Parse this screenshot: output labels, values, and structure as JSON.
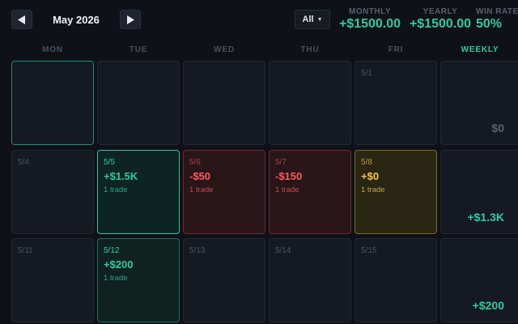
{
  "header": {
    "month": "May 2026",
    "filter_label": "All",
    "stats": {
      "monthly_label": "MONTHLY",
      "monthly_value": "+$1500.00",
      "yearly_label": "YEARLY",
      "yearly_value": "+$1500.00",
      "winrate_label": "WIN RATE",
      "winrate_value": "50%"
    }
  },
  "weekdays": [
    "MON",
    "TUE",
    "WED",
    "THU",
    "FRI",
    "WEEKLY"
  ],
  "weeks": [
    {
      "days": [
        {
          "date": "",
          "pnl": "",
          "trades": "",
          "status": "today"
        },
        {
          "date": "",
          "pnl": "",
          "trades": "",
          "status": "none"
        },
        {
          "date": "",
          "pnl": "",
          "trades": "",
          "status": "none"
        },
        {
          "date": "",
          "pnl": "",
          "trades": "",
          "status": "none"
        },
        {
          "date": "5/1",
          "pnl": "",
          "trades": "",
          "status": "none"
        }
      ],
      "weekly": "$0"
    },
    {
      "days": [
        {
          "date": "5/4",
          "pnl": "",
          "trades": "",
          "status": "none"
        },
        {
          "date": "5/5",
          "pnl": "+$1.5K",
          "trades": "1 trade",
          "status": "win"
        },
        {
          "date": "5/6",
          "pnl": "-$50",
          "trades": "1 trade",
          "status": "loss"
        },
        {
          "date": "5/7",
          "pnl": "-$150",
          "trades": "1 trade",
          "status": "loss"
        },
        {
          "date": "5/8",
          "pnl": "+$0",
          "trades": "1 trade",
          "status": "even"
        }
      ],
      "weekly": "+$1.3K"
    },
    {
      "days": [
        {
          "date": "5/11",
          "pnl": "",
          "trades": "",
          "status": "none"
        },
        {
          "date": "5/12",
          "pnl": "+$200",
          "trades": "1 trade",
          "status": "win2"
        },
        {
          "date": "5/13",
          "pnl": "",
          "trades": "",
          "status": "none"
        },
        {
          "date": "5/14",
          "pnl": "",
          "trades": "",
          "status": "none"
        },
        {
          "date": "5/15",
          "pnl": "",
          "trades": "",
          "status": "none"
        }
      ],
      "weekly": "+$200"
    }
  ],
  "colors": {
    "profit": "#2ecc9f",
    "loss": "#ff5a5f",
    "breakeven": "#f4c542",
    "background": "#0e1117"
  },
  "icons": {
    "prev": "triangle-left-icon",
    "next": "triangle-right-icon",
    "dropdown": "caret-down-icon"
  }
}
